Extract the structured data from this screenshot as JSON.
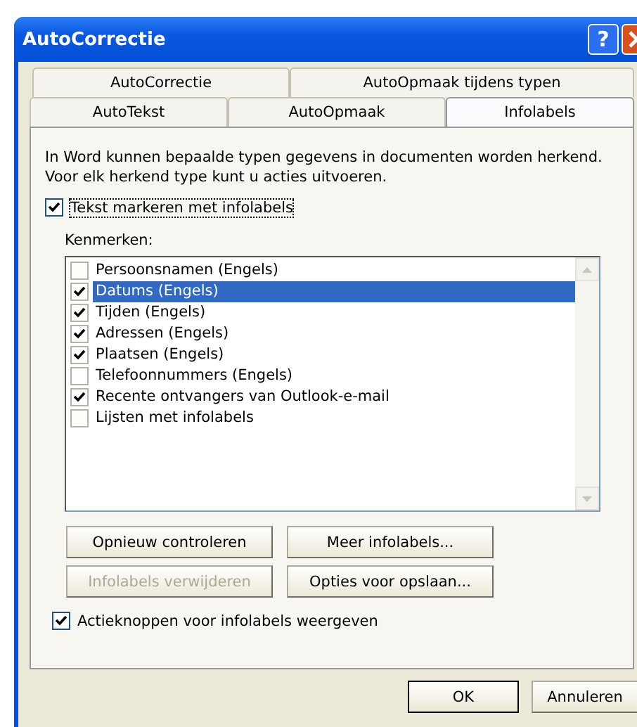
{
  "window": {
    "title": "AutoCorrectie",
    "help_button": "?"
  },
  "tab_rows": [
    [
      {
        "label": "AutoCorrectie",
        "selected": false
      },
      {
        "label": "AutoOpmaak tijdens typen",
        "selected": false
      }
    ],
    [
      {
        "label": "AutoTekst",
        "selected": false
      },
      {
        "label": "AutoOpmaak",
        "selected": false
      },
      {
        "label": "Infolabels",
        "selected": true
      }
    ]
  ],
  "description": "In Word kunnen bepaalde typen gegevens in documenten worden herkend. Voor elk herkend type kunt u acties uitvoeren.",
  "mark_text": {
    "label": "Tekst markeren met infolabels",
    "checked": true
  },
  "list_label": "Kenmerken:",
  "recognizers": [
    {
      "label": "Persoonsnamen (Engels)",
      "checked": false,
      "selected": false
    },
    {
      "label": "Datums (Engels)",
      "checked": true,
      "selected": true
    },
    {
      "label": "Tijden (Engels)",
      "checked": true,
      "selected": false
    },
    {
      "label": "Adressen (Engels)",
      "checked": true,
      "selected": false
    },
    {
      "label": "Plaatsen (Engels)",
      "checked": true,
      "selected": false
    },
    {
      "label": "Telefoonnummers (Engels)",
      "checked": false,
      "selected": false
    },
    {
      "label": "Recente ontvangers van Outlook-e-mail",
      "checked": true,
      "selected": false
    },
    {
      "label": "Lijsten met infolabels",
      "checked": false,
      "selected": false
    }
  ],
  "action_buttons": [
    {
      "label": "Opnieuw controleren",
      "disabled": false
    },
    {
      "label": "Meer infolabels...",
      "disabled": false
    },
    {
      "label": "Infolabels verwijderen",
      "disabled": true
    },
    {
      "label": "Opties voor opslaan...",
      "disabled": false
    }
  ],
  "show_buttons": {
    "label": "Actieknoppen voor infolabels weergeven",
    "checked": true
  },
  "footer_buttons": [
    "OK",
    "Annuleren"
  ]
}
